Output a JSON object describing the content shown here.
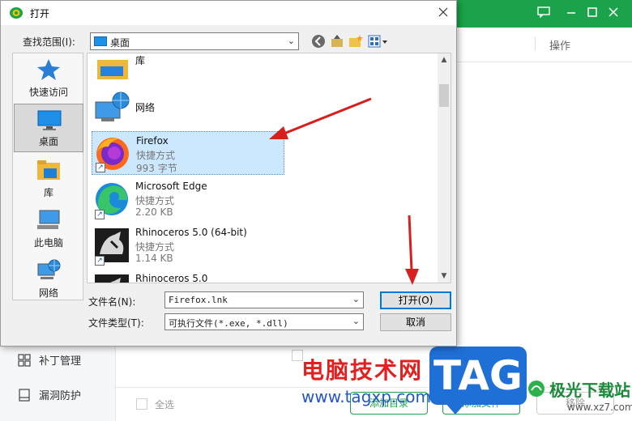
{
  "background_app": {
    "operations_label": "操作",
    "sidebar_items": [
      {
        "label": "补丁管理",
        "icon": "grid-icon"
      },
      {
        "label": "漏洞防护",
        "icon": "shield-doc-icon"
      }
    ],
    "select_all_label": "全选",
    "bottom_buttons": [
      "添加目录",
      "添加文件",
      "移除"
    ]
  },
  "watermark": {
    "site_cn": "电脑技术网",
    "site_url": "www.tagxp.com",
    "tag_logo": "TAG",
    "site2_cn": "极光下载站",
    "site2_url": "www.xz7.com"
  },
  "dialog": {
    "title": "打开",
    "look_in_label": "查找范围(I):",
    "look_in_value": "桌面",
    "places": [
      {
        "label": "快速访问",
        "icon": "star-icon",
        "selected": false
      },
      {
        "label": "桌面",
        "icon": "desktop-icon",
        "selected": true
      },
      {
        "label": "库",
        "icon": "library-folder-icon",
        "selected": false
      },
      {
        "label": "此电脑",
        "icon": "computer-icon",
        "selected": false
      },
      {
        "label": "网络",
        "icon": "network-icon",
        "selected": false
      }
    ],
    "files": [
      {
        "name": "库",
        "icon": "library-folder-icon"
      },
      {
        "name": "网络",
        "icon": "network-icon"
      },
      {
        "name": "Firefox",
        "type": "快捷方式",
        "size": "993 字节",
        "icon": "firefox-icon",
        "selected": true
      },
      {
        "name": "Microsoft Edge",
        "type": "快捷方式",
        "size": "2.20 KB",
        "icon": "edge-icon"
      },
      {
        "name": "Rhinoceros 5.0 (64-bit)",
        "type": "快捷方式",
        "size": "1.14 KB",
        "icon": "rhino-icon"
      },
      {
        "name": "Rhinoceros 5.0",
        "icon": "rhino-icon"
      }
    ],
    "file_name_label": "文件名(N):",
    "file_name_value": "Firefox.lnk",
    "file_type_label": "文件类型(T):",
    "file_type_value": "可执行文件(*.exe, *.dll)",
    "open_button": "打开(O)",
    "cancel_button": "取消"
  },
  "colors": {
    "app_green": "#1aa34a",
    "selection": "#cce8ff",
    "annotation_red": "#d81e1e",
    "watermark_red": "#e32020",
    "watermark_blue": "#1e6fd6"
  }
}
